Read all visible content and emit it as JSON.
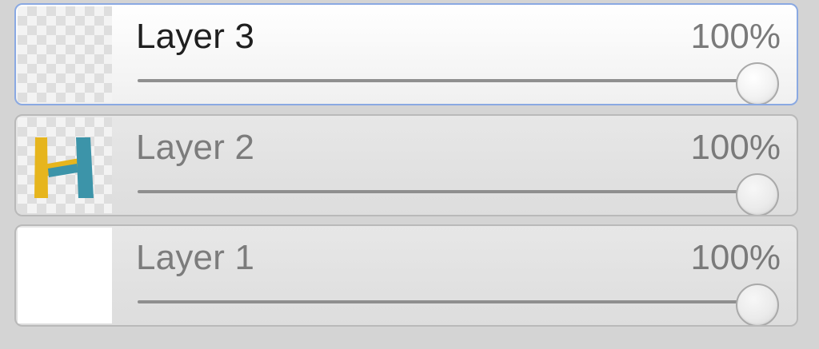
{
  "panel": {
    "layers": [
      {
        "name": "Layer 3",
        "opacity_text": "100%",
        "opacity_value": 100,
        "selected": true,
        "thumbnail": "transparent"
      },
      {
        "name": "Layer 2",
        "opacity_text": "100%",
        "opacity_value": 100,
        "selected": false,
        "thumbnail": "yellow-blue-h-logo"
      },
      {
        "name": "Layer 1",
        "opacity_text": "100%",
        "opacity_value": 100,
        "selected": false,
        "thumbnail": "white"
      }
    ]
  },
  "colors": {
    "selected_border": "#8aa9e2",
    "logo_yellow": "#e6b51d",
    "logo_blue": "#3c94a9"
  }
}
